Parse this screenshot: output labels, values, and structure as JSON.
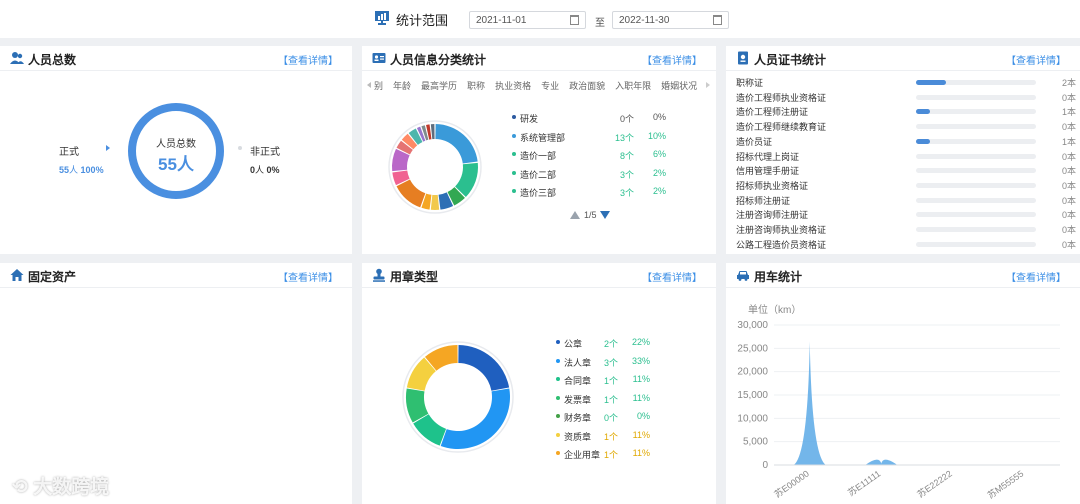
{
  "topbar": {
    "title": "统计范围",
    "start_date": "2021-11-01",
    "sep": "至",
    "end_date": "2022-11-30"
  },
  "more_label": "【查看详情】",
  "staff_total": {
    "title": "人员总数",
    "center_label": "人员总数",
    "center_value": "55人",
    "formal_label": "正式",
    "formal_count": "55",
    "formal_unit": "人",
    "formal_pct": "100%",
    "informal_label": "非正式",
    "informal_count": "0",
    "informal_unit": "人",
    "informal_pct": "0%",
    "accent": "#4a8fe0"
  },
  "staff_info": {
    "title": "人员信息分类统计",
    "tabs": [
      "别",
      "年龄",
      "最高学历",
      "职称",
      "执业资格",
      "专业",
      "政治面貌",
      "入职年限",
      "婚姻状况"
    ],
    "legend": [
      {
        "name": "研发",
        "count": "0个",
        "pct": "0%",
        "color": "#2c5aa0"
      },
      {
        "name": "系统管理部",
        "count": "13个",
        "pct": "10%",
        "color": "#3a9ad9"
      },
      {
        "name": "造价一部",
        "count": "8个",
        "pct": "6%",
        "color": "#2bbf8f"
      },
      {
        "name": "造价二部",
        "count": "3个",
        "pct": "2%",
        "color": "#2bbf8f"
      },
      {
        "name": "造价三部",
        "count": "3个",
        "pct": "2%",
        "color": "#2bbf8f"
      }
    ],
    "page": "1/5",
    "donut_colors": [
      "#3a9ad9",
      "#2bbf8f",
      "#32a852",
      "#2c6fb5",
      "#f2c94c",
      "#f5a623",
      "#e67e22",
      "#f06292",
      "#ba68c8",
      "#e57373",
      "#ff8a65",
      "#4db6ac",
      "#9575cd",
      "#7f8c8d",
      "#c0392b",
      "#5d6d7e"
    ],
    "donut_values": [
      13,
      8,
      3,
      3,
      2,
      2,
      7,
      3,
      5,
      2,
      2,
      2,
      1,
      1,
      1,
      1
    ]
  },
  "certs": {
    "title": "人员证书统计",
    "items": [
      {
        "name": "职称证",
        "value": "2本",
        "fill": 0.25
      },
      {
        "name": "造价工程师执业资格证",
        "value": "0本",
        "fill": 0
      },
      {
        "name": "造价工程师注册证",
        "value": "1本",
        "fill": 0.12
      },
      {
        "name": "造价工程师继续教育证",
        "value": "0本",
        "fill": 0
      },
      {
        "name": "造价员证",
        "value": "1本",
        "fill": 0.12
      },
      {
        "name": "招标代理上岗证",
        "value": "0本",
        "fill": 0
      },
      {
        "name": "信用管理手册证",
        "value": "0本",
        "fill": 0
      },
      {
        "name": "招标师执业资格证",
        "value": "0本",
        "fill": 0
      },
      {
        "name": "招标师注册证",
        "value": "0本",
        "fill": 0
      },
      {
        "name": "注册咨询师注册证",
        "value": "0本",
        "fill": 0
      },
      {
        "name": "注册咨询师执业资格证",
        "value": "0本",
        "fill": 0
      },
      {
        "name": "公路工程造价员资格证",
        "value": "0本",
        "fill": 0
      }
    ]
  },
  "fixed_assets": {
    "title": "固定资产"
  },
  "seal_types": {
    "title": "用章类型",
    "legend": [
      {
        "name": "公章",
        "count": "2个",
        "pct": "22%",
        "color": "#1f5fbf"
      },
      {
        "name": "法人章",
        "count": "3个",
        "pct": "33%",
        "color": "#2196f3"
      },
      {
        "name": "合同章",
        "count": "1个",
        "pct": "11%",
        "color": "#1ec28b"
      },
      {
        "name": "发票章",
        "count": "1个",
        "pct": "11%",
        "color": "#2fbf71"
      },
      {
        "name": "财务章",
        "count": "0个",
        "pct": "0%",
        "color": "#43a047"
      },
      {
        "name": "资质章",
        "count": "1个",
        "pct": "11%",
        "color": "#f4d03f"
      },
      {
        "name": "企业用章",
        "count": "1个",
        "pct": "11%",
        "color": "#f5a623"
      }
    ]
  },
  "vehicles": {
    "title": "用车统计",
    "unit_label": "单位（km）"
  },
  "chart_data": {
    "type": "area",
    "categories": [
      "苏E00000",
      "苏E11111",
      "苏E22222",
      "苏M55555"
    ],
    "values": [
      26500,
      300,
      0,
      0
    ],
    "ylabel": "单位（km）",
    "ylim": [
      0,
      30000
    ],
    "yticks": [
      "30,000",
      "25,000",
      "20,000",
      "15,000",
      "10,000",
      "5,000",
      "0"
    ],
    "grid": true,
    "color": "#5aa9e6"
  },
  "watermark": "大数跨境",
  "colors": {
    "link": "#3a8ee6",
    "green_text": "#2bbf8f",
    "gold_text": "#e0a800"
  }
}
